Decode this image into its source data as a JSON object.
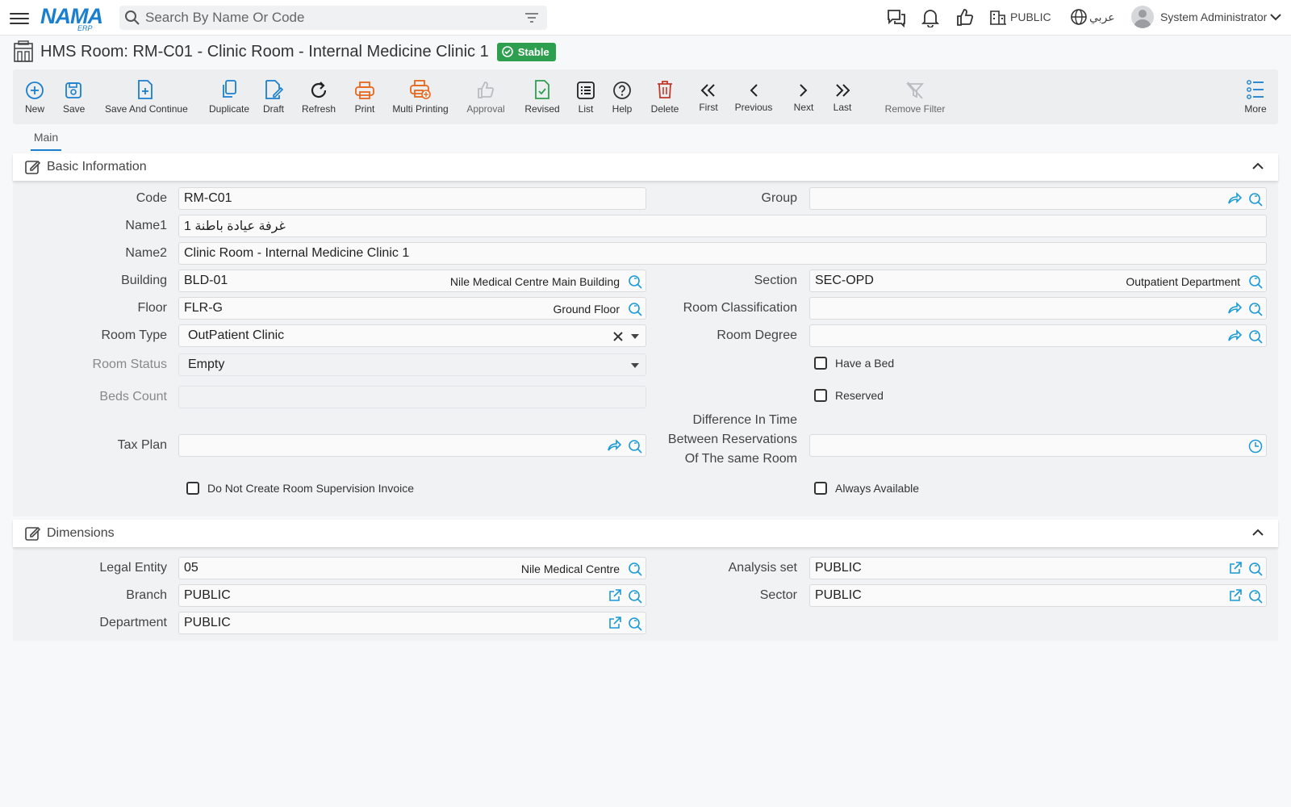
{
  "topbar": {
    "logo_text": "NAMA",
    "logo_sub": "ERP",
    "search_placeholder": "Search By Name Or Code",
    "company": "PUBLIC",
    "language": "عربي",
    "user": "System Administrator"
  },
  "header": {
    "title": "HMS Room: RM-C01 - Clinic Room - Internal Medicine Clinic 1",
    "status": "Stable"
  },
  "toolbar": {
    "new": "New",
    "save": "Save",
    "save_continue": "Save And Continue",
    "duplicate": "Duplicate",
    "draft": "Draft",
    "refresh": "Refresh",
    "print": "Print",
    "multi_printing": "Multi Printing",
    "approval": "Approval",
    "revised": "Revised",
    "list": "List",
    "help": "Help",
    "delete": "Delete",
    "first": "First",
    "previous": "Previous",
    "next": "Next",
    "last": "Last",
    "remove_filter": "Remove Filter",
    "more": "More"
  },
  "tabs": {
    "main": "Main"
  },
  "basic": {
    "title": "Basic Information",
    "code_label": "Code",
    "code": "RM-C01",
    "group_label": "Group",
    "group": "",
    "name1_label": "Name1",
    "name1": "غرفة عيادة باطنة 1",
    "name2_label": "Name2",
    "name2": "Clinic Room - Internal Medicine Clinic 1",
    "building_label": "Building",
    "building_code": "BLD-01",
    "building_name": "Nile Medical Centre Main Building",
    "section_label": "Section",
    "section_code": "SEC-OPD",
    "section_name": "Outpatient Department",
    "floor_label": "Floor",
    "floor_code": "FLR-G",
    "floor_name": "Ground Floor",
    "room_class_label": "Room Classification",
    "room_type_label": "Room Type",
    "room_type": "OutPatient Clinic",
    "room_degree_label": "Room Degree",
    "room_status_label": "Room Status",
    "room_status": "Empty",
    "have_bed": "Have a Bed",
    "beds_count_label": "Beds Count",
    "reserved": "Reserved",
    "tax_plan_label": "Tax Plan",
    "diff_time_l1": "Difference In Time",
    "diff_time_l2": "Between Reservations",
    "diff_time_l3": "Of The same Room",
    "no_supervision": "Do Not Create Room Supervision Invoice",
    "always_available": "Always Available"
  },
  "dimensions": {
    "title": "Dimensions",
    "legal_label": "Legal Entity",
    "legal_code": "05",
    "legal_name": "Nile Medical Centre",
    "analysis_label": "Analysis set",
    "analysis": "PUBLIC",
    "branch_label": "Branch",
    "branch": "PUBLIC",
    "sector_label": "Sector",
    "sector": "PUBLIC",
    "department_label": "Department",
    "department": "PUBLIC"
  },
  "colors": {
    "accent": "#1a7fcf",
    "print": "#e8671e",
    "delete": "#c0392b",
    "revised": "#2e9e4f",
    "badge": "#2e9e4f"
  }
}
